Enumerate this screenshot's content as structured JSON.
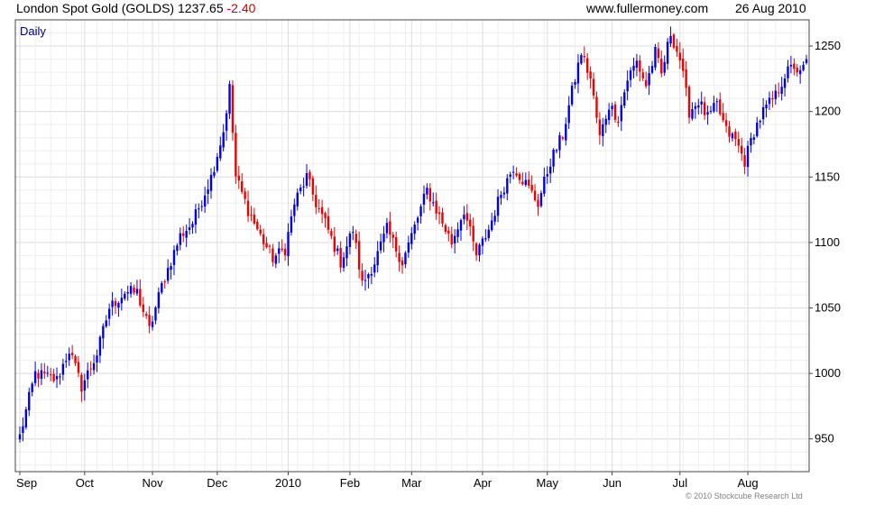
{
  "header": {
    "title": "London Spot Gold (GOLDS)",
    "price": "1237.65",
    "change": "-2.40",
    "website": "www.fullermoney.com",
    "date": "26 Aug 2010"
  },
  "footer": {
    "copyright": "© 2010 Stockcube Research Ltd"
  },
  "colors": {
    "up": "#0000ee",
    "down": "#ee0000",
    "grid": "#dddddd",
    "grid_minor": "#eeeeee",
    "axis": "#444444",
    "period_label": "#000080"
  },
  "chart_data": {
    "type": "candlestick",
    "period_label": "Daily",
    "ylim": [
      925,
      1270
    ],
    "yticks": [
      950,
      1000,
      1050,
      1100,
      1150,
      1200,
      1250
    ],
    "ytick_labels": [
      "950",
      "1000",
      "1050",
      "1100",
      "1150",
      "1200",
      "1250"
    ],
    "y_axis_side": "right",
    "grid": true,
    "xlabels": [
      "Sep",
      "Oct",
      "Nov",
      "Dec",
      "2010",
      "Feb",
      "Mar",
      "Apr",
      "May",
      "Jun",
      "Jul",
      "Aug"
    ],
    "xlabel_bar_index": [
      0,
      21,
      43,
      64,
      87,
      107,
      127,
      150,
      171,
      192,
      214,
      236
    ],
    "bar_count": 256,
    "close_path": [
      [
        0,
        952
      ],
      [
        5,
        1000
      ],
      [
        12,
        995
      ],
      [
        16,
        1018
      ],
      [
        20,
        990
      ],
      [
        25,
        1015
      ],
      [
        29,
        1050
      ],
      [
        34,
        1062
      ],
      [
        38,
        1062
      ],
      [
        42,
        1033
      ],
      [
        46,
        1067
      ],
      [
        52,
        1105
      ],
      [
        56,
        1115
      ],
      [
        62,
        1150
      ],
      [
        66,
        1185
      ],
      [
        68,
        1218
      ],
      [
        70,
        1150
      ],
      [
        74,
        1125
      ],
      [
        78,
        1105
      ],
      [
        82,
        1088
      ],
      [
        86,
        1095
      ],
      [
        89,
        1130
      ],
      [
        93,
        1150
      ],
      [
        96,
        1130
      ],
      [
        99,
        1115
      ],
      [
        104,
        1085
      ],
      [
        108,
        1110
      ],
      [
        111,
        1068
      ],
      [
        115,
        1085
      ],
      [
        119,
        1110
      ],
      [
        124,
        1085
      ],
      [
        128,
        1112
      ],
      [
        132,
        1140
      ],
      [
        136,
        1120
      ],
      [
        140,
        1100
      ],
      [
        144,
        1125
      ],
      [
        148,
        1090
      ],
      [
        152,
        1110
      ],
      [
        156,
        1138
      ],
      [
        160,
        1158
      ],
      [
        164,
        1145
      ],
      [
        168,
        1130
      ],
      [
        172,
        1162
      ],
      [
        176,
        1182
      ],
      [
        179,
        1215
      ],
      [
        182,
        1245
      ],
      [
        185,
        1225
      ],
      [
        188,
        1180
      ],
      [
        191,
        1205
      ],
      [
        194,
        1195
      ],
      [
        197,
        1225
      ],
      [
        200,
        1238
      ],
      [
        203,
        1220
      ],
      [
        206,
        1245
      ],
      [
        208,
        1228
      ],
      [
        211,
        1260
      ],
      [
        214,
        1240
      ],
      [
        217,
        1200
      ],
      [
        220,
        1208
      ],
      [
        223,
        1195
      ],
      [
        226,
        1205
      ],
      [
        229,
        1185
      ],
      [
        232,
        1178
      ],
      [
        235,
        1162
      ],
      [
        238,
        1185
      ],
      [
        241,
        1200
      ],
      [
        245,
        1212
      ],
      [
        248,
        1228
      ],
      [
        251,
        1235
      ],
      [
        253,
        1228
      ],
      [
        255,
        1238
      ]
    ]
  }
}
